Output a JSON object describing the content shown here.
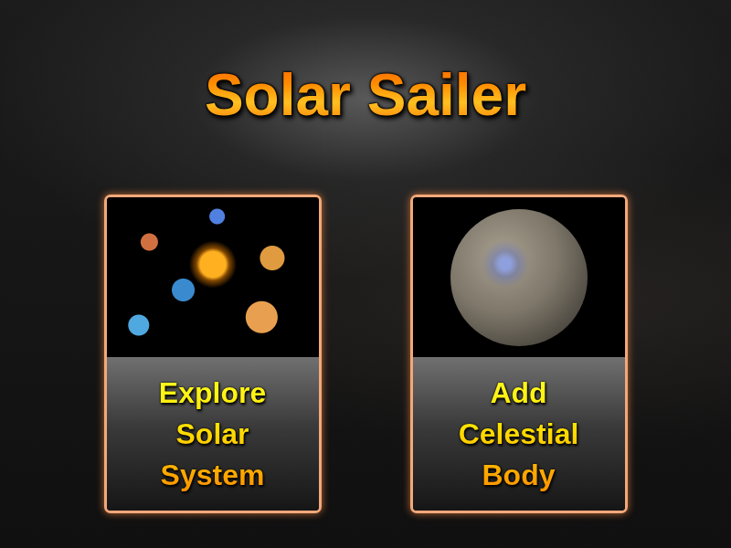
{
  "title": "Solar Sailer",
  "cards": [
    {
      "kind": "system",
      "lines": [
        "Explore",
        "Solar",
        "System"
      ]
    },
    {
      "kind": "planet",
      "lines": [
        "Add",
        "Celestial",
        "Body"
      ]
    }
  ]
}
